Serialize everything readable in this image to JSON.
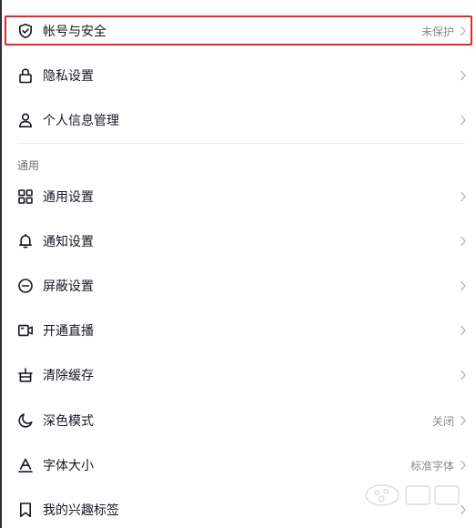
{
  "account_section": {
    "items": [
      {
        "label": "帐号与安全",
        "value": "未保护",
        "icon": "shield-check-icon"
      },
      {
        "label": "隐私设置",
        "value": "",
        "icon": "lock-icon"
      },
      {
        "label": "个人信息管理",
        "value": "",
        "icon": "person-icon"
      }
    ]
  },
  "general_section": {
    "title": "通用",
    "items": [
      {
        "label": "通用设置",
        "value": "",
        "icon": "grid-icon"
      },
      {
        "label": "通知设置",
        "value": "",
        "icon": "bell-icon"
      },
      {
        "label": "屏蔽设置",
        "value": "",
        "icon": "block-icon"
      },
      {
        "label": "开通直播",
        "value": "",
        "icon": "video-camera-icon"
      },
      {
        "label": "清除缓存",
        "value": "",
        "icon": "basket-icon"
      },
      {
        "label": "深色模式",
        "value": "关闭",
        "icon": "moon-icon"
      },
      {
        "label": "字体大小",
        "value": "标准字体",
        "icon": "font-size-icon"
      },
      {
        "label": "我的兴趣标签",
        "value": "",
        "icon": "bookmark-icon"
      }
    ]
  },
  "highlight_color": "#e0272a"
}
